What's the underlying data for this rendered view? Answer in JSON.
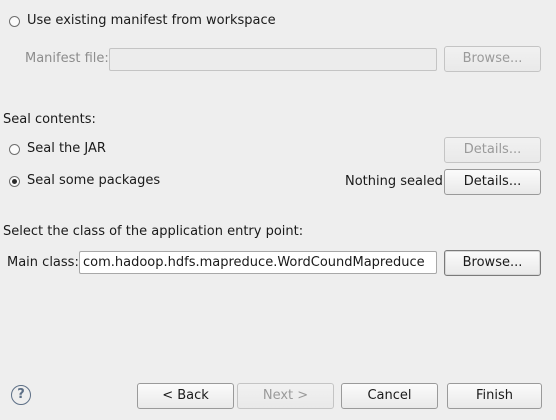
{
  "manifest": {
    "use_existing_label": "Use existing manifest from workspace",
    "manifest_file_label": "Manifest file:",
    "manifest_file_value": "",
    "browse_label": "Browse..."
  },
  "seal": {
    "heading": "Seal contents:",
    "seal_jar_label": "Seal the JAR",
    "seal_jar_details_label": "Details...",
    "seal_packages_label": "Seal some packages",
    "status_text": "Nothing sealed",
    "seal_packages_details_label": "Details..."
  },
  "entry_point": {
    "heading": "Select the class of the application entry point:",
    "main_class_label": "Main class:",
    "main_class_value": "com.hadoop.hdfs.mapreduce.WordCoundMapreduce",
    "browse_label": "Browse..."
  },
  "footer": {
    "help_glyph": "?",
    "back_label": "< Back",
    "next_label": "Next >",
    "cancel_label": "Cancel",
    "finish_label": "Finish"
  }
}
